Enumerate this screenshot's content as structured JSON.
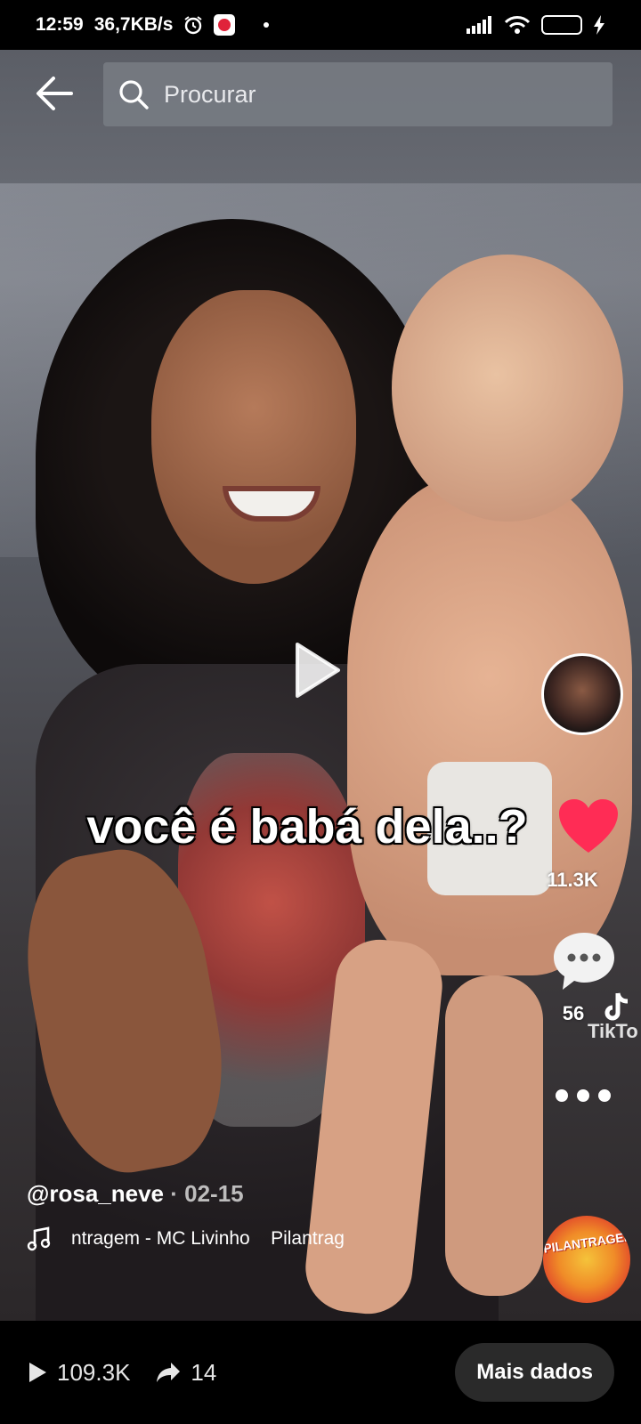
{
  "status_bar": {
    "time": "12:59",
    "speed": "36,7KB/s",
    "battery": "63",
    "icons": [
      "alarm-icon",
      "app-notification-icon",
      "signal-icon",
      "wifi-icon",
      "battery-icon",
      "charging-icon"
    ]
  },
  "search": {
    "placeholder": "Procurar"
  },
  "video": {
    "caption": "você é babá dela..?",
    "likes": "11.3K",
    "comments": "56",
    "watermark_brand": "TikTo",
    "username": "@rosa_neve",
    "date": "· 02-15",
    "music_text": "ntragem - MC Livinho    Pilantrag",
    "disc_label": "PILANTRAGEM"
  },
  "bottom_bar": {
    "plays": "109.3K",
    "shares": "14",
    "more_label": "Mais dados"
  },
  "colors": {
    "heart": "#ff2c55",
    "battery_fill": "#b6f43a",
    "search_bg": "#787c84"
  }
}
